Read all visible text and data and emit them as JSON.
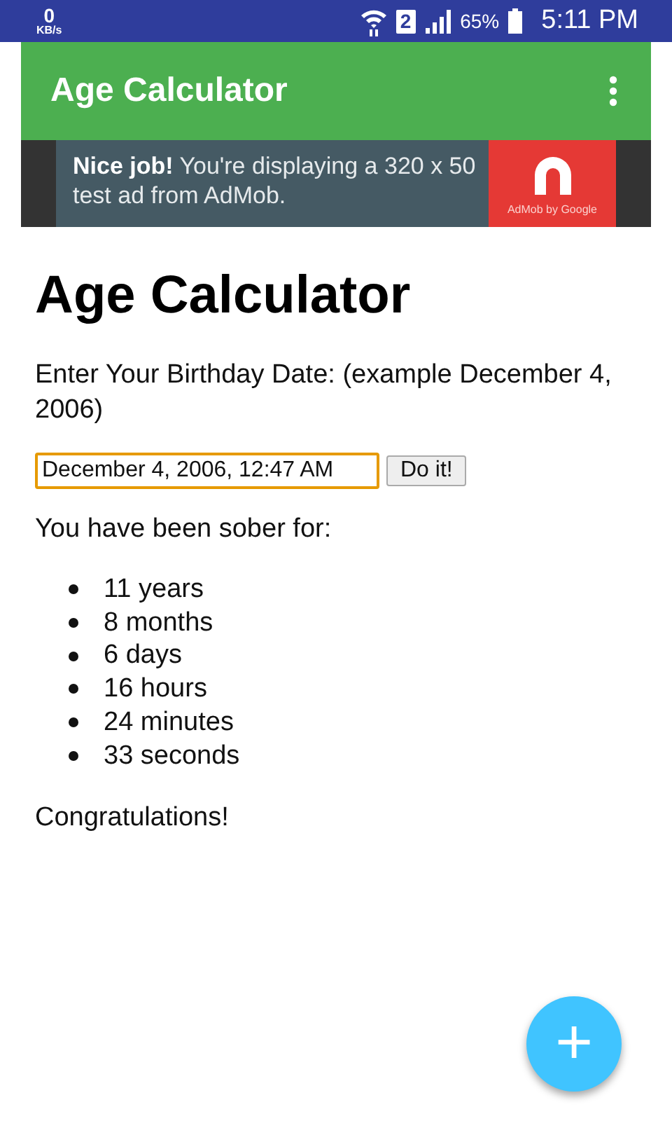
{
  "status_bar": {
    "net_speed": "0",
    "net_unit": "KB/s",
    "sim": "2",
    "battery": "65%",
    "time": "5:11 PM"
  },
  "app_bar": {
    "title": "Age Calculator"
  },
  "ad": {
    "text": "**Nice job!** You're displaying a 320 x 50 test ad from AdMob.",
    "brand": "AdMob by Google"
  },
  "heading": "Age Calculator",
  "prompt": "Enter Your Birthday Date: (example December 4, 2006)",
  "date_field": {
    "value": "December 4, 2006, 12:47 AM",
    "focused": true
  },
  "submit_button": "Do it!",
  "result_intro": "You have been sober for:",
  "results": [
    "11 years",
    "8 months",
    "6 days",
    "16 hours",
    "24 minutes",
    "33 seconds"
  ],
  "message": "Congratulations!",
  "fab": {
    "label": "+"
  }
}
